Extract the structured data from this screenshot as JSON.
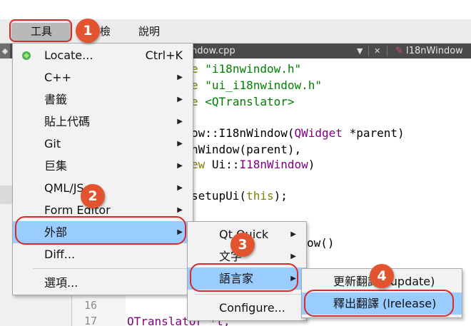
{
  "menubar": {
    "tools": "工具",
    "partial": "檢",
    "help": "說明"
  },
  "tabbar": {
    "file_tab": "ndow.cpp",
    "second_tab": "I18nWindow",
    "dropdown_glyph": "▼",
    "close_glyph": "✕",
    "split_glyph": "◆"
  },
  "gutter": {
    "line_numbers": [
      "16",
      "17"
    ]
  },
  "code": {
    "line1": {
      "kw": "e",
      "str": "\"i18nwindow.h\""
    },
    "line2": {
      "kw": "e",
      "str": "\"ui_i18nwindow.h\""
    },
    "line3": {
      "kw": "e",
      "str": "<QTranslator>"
    },
    "line4": {
      "a": "ow::I18nWindow(",
      "b": "QWidget",
      "c": " *parent)"
    },
    "line5": {
      "a": "nWindow(parent),"
    },
    "line6": {
      "kw": "ew",
      "b": " Ui::",
      "c": "I18nWindow",
      "d": ")"
    },
    "line7": {
      "a": "setupUi(",
      "b": "this",
      "c": ");"
    },
    "line8": {
      "a": "ow()"
    },
    "line9": {
      "a": "OTranslator *t;"
    }
  },
  "tools_menu": {
    "items": [
      {
        "label": "Locate...",
        "shortcut": "Ctrl+K"
      },
      {
        "label": "C++"
      },
      {
        "label": "書籤"
      },
      {
        "label": "貼上代碼"
      },
      {
        "label": "Git"
      },
      {
        "label": "巨集"
      },
      {
        "label": "QML/JS"
      },
      {
        "label": "Form Editor"
      },
      {
        "label": "外部"
      },
      {
        "label": "Diff..."
      },
      {
        "label": "選項..."
      }
    ]
  },
  "external_menu": {
    "items": [
      {
        "label": "Qt Quick"
      },
      {
        "label": "文字"
      },
      {
        "label": "語言家"
      },
      {
        "label": "Configure..."
      }
    ]
  },
  "linguist_menu": {
    "items": [
      {
        "label": "更新翻譯 (lupdate)"
      },
      {
        "label": "釋出翻譯 (lrelease)"
      }
    ]
  },
  "badges": [
    "1",
    "2",
    "3",
    "4"
  ],
  "arrow_glyph": "▶",
  "colors": {
    "highlight": "#99ccff",
    "badge": "#e2542f",
    "ring": "#d92a2a"
  }
}
